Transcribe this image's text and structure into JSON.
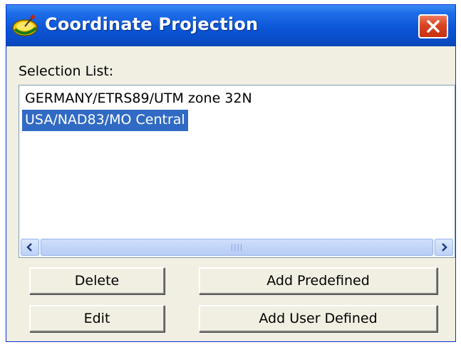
{
  "window": {
    "title": "Coordinate Projection",
    "app_icon": "satellite-dish-icon",
    "close_icon": "close-icon"
  },
  "selection_list": {
    "label": "Selection List:",
    "items": [
      {
        "label": "GERMANY/ETRS89/UTM zone 32N",
        "selected": false
      },
      {
        "label": "USA/NAD83/MO Central",
        "selected": true
      }
    ],
    "scroll_left_icon": "chevron-left-icon",
    "scroll_right_icon": "chevron-right-icon"
  },
  "buttons": {
    "delete_label": "Delete",
    "edit_label": "Edit",
    "add_predefined_label": "Add Predefined",
    "add_user_defined_label": "Add User Defined"
  },
  "colors": {
    "title_bar": "#0c56d8",
    "selection_highlight": "#316ac5",
    "close_button": "#d9431f",
    "window_face": "#f1efe2"
  }
}
